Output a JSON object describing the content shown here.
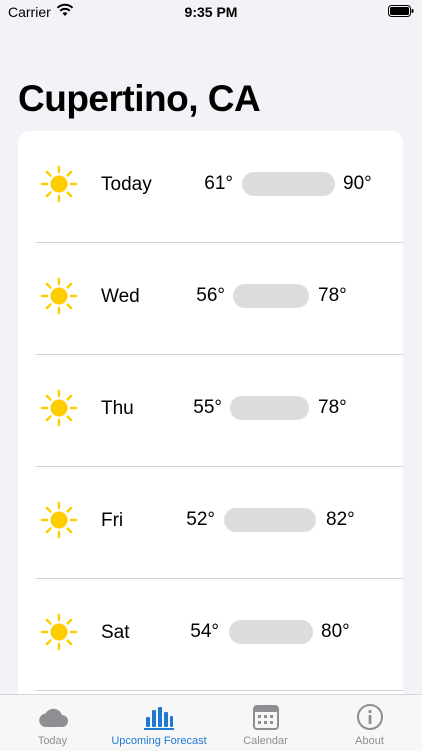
{
  "status_bar": {
    "carrier": "Carrier",
    "time": "9:35 PM"
  },
  "header": {
    "city": "Cupertino, CA"
  },
  "forecast": [
    {
      "day": "Today",
      "low": "61°",
      "high": "90°",
      "icon": "sun-icon"
    },
    {
      "day": "Wed",
      "low": "56°",
      "high": "78°",
      "icon": "sun-icon"
    },
    {
      "day": "Thu",
      "low": "55°",
      "high": "78°",
      "icon": "sun-icon"
    },
    {
      "day": "Fri",
      "low": "52°",
      "high": "82°",
      "icon": "sun-icon"
    },
    {
      "day": "Sat",
      "low": "54°",
      "high": "80°",
      "icon": "sun-icon"
    }
  ],
  "tabs": [
    {
      "label": "Today",
      "icon": "cloud-icon",
      "active": false
    },
    {
      "label": "Upcoming Forecast",
      "icon": "bar-chart-icon",
      "active": true
    },
    {
      "label": "Calendar",
      "icon": "calendar-icon",
      "active": false
    },
    {
      "label": "About",
      "icon": "info-icon",
      "active": false
    }
  ],
  "colors": {
    "accent": "#1f78d1",
    "sun": "#ffcc00",
    "inactive": "#8e8e93",
    "bar": "#dcdcdc"
  }
}
